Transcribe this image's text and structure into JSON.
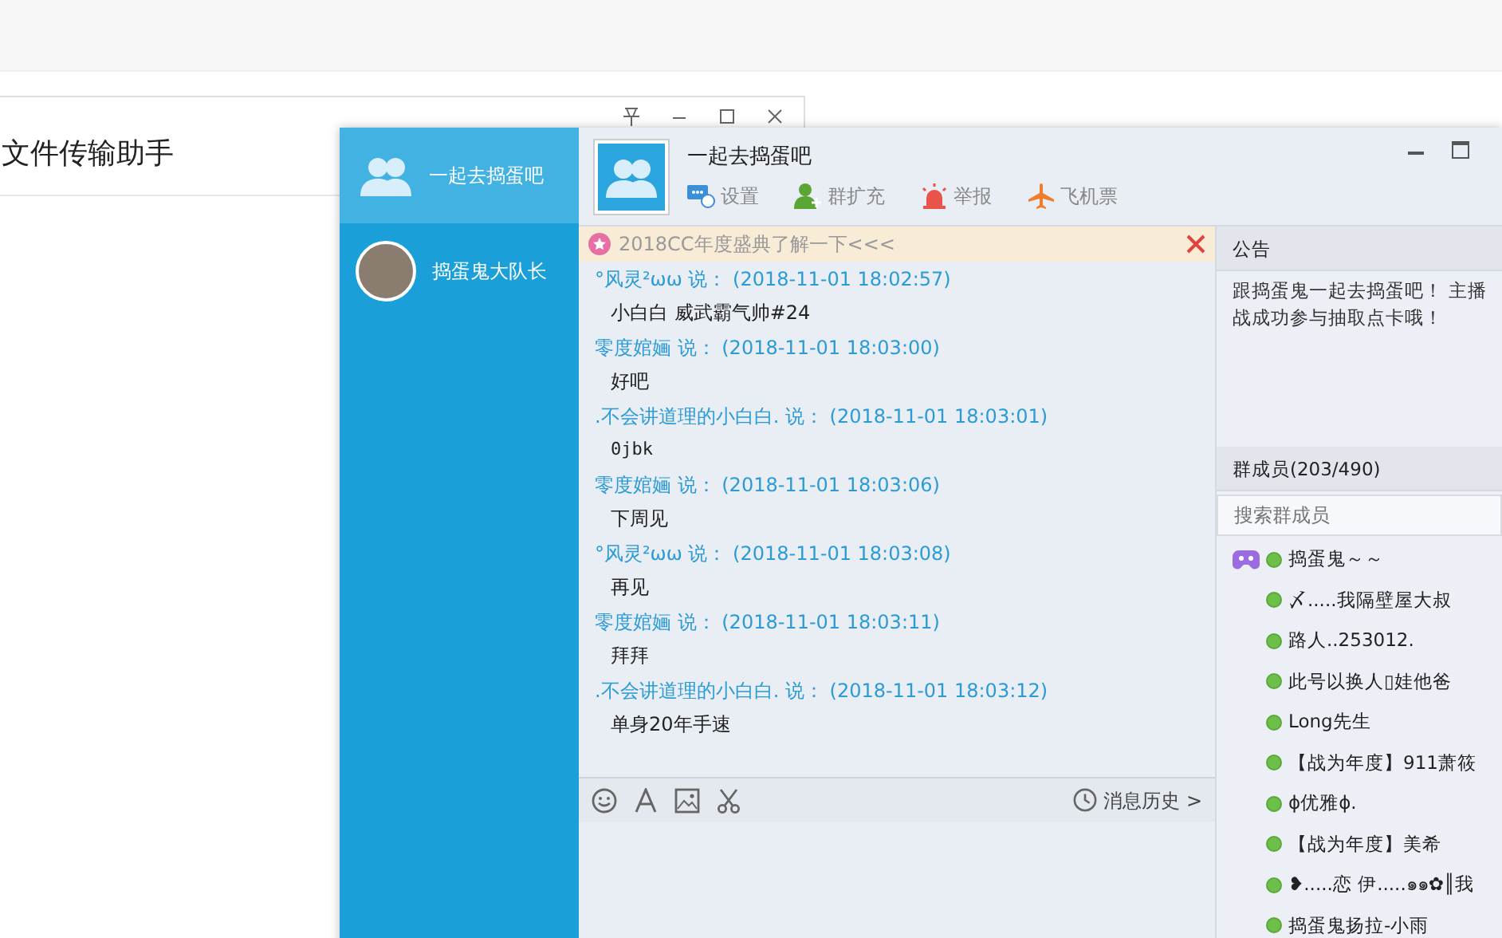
{
  "back_window": {
    "title": "文件传输助手"
  },
  "chat_window": {
    "sessions": [
      {
        "name": "一起去捣蛋吧",
        "kind": "group",
        "selected": true
      },
      {
        "name": "捣蛋鬼大队长",
        "kind": "photo",
        "selected": false
      }
    ],
    "group_name": "一起去捣蛋吧",
    "tools": [
      {
        "label": "设置",
        "kind": "settings"
      },
      {
        "label": "群扩充",
        "kind": "expand"
      },
      {
        "label": "举报",
        "kind": "report"
      },
      {
        "label": "飞机票",
        "kind": "flight"
      }
    ],
    "banner": "2018CC年度盛典了解一下<<<",
    "messages": [
      {
        "sender": "°风灵²ωω",
        "said": "说：",
        "time": "(2018-11-01 18:02:57)",
        "text": "小白白 威武霸气帅#24",
        "kind": "text"
      },
      {
        "sender": "零度婠婳",
        "said": "说：",
        "time": "(2018-11-01 18:03:00)",
        "text": "好吧",
        "kind": "text"
      },
      {
        "sender": ".不会讲道理的小白白.",
        "said": "说：",
        "time": "(2018-11-01 18:03:01)",
        "text": "0jbk",
        "kind": "mono"
      },
      {
        "sender": "零度婠婳",
        "said": "说：",
        "time": "(2018-11-01 18:03:06)",
        "text": "下周见",
        "kind": "text"
      },
      {
        "sender": "°风灵²ωω",
        "said": "说：",
        "time": "(2018-11-01 18:03:08)",
        "text": "再见",
        "kind": "text"
      },
      {
        "sender": "零度婠婳",
        "said": "说：",
        "time": "(2018-11-01 18:03:11)",
        "text": "拜拜",
        "kind": "text"
      },
      {
        "sender": ".不会讲道理的小白白.",
        "said": "说：",
        "time": "(2018-11-01 18:03:12)",
        "text": "单身20年手速",
        "kind": "text"
      }
    ],
    "history_label": "消息历史 >",
    "notice": {
      "title": "公告",
      "lines": [
        "跟捣蛋鬼一起去捣蛋吧！ 主播",
        "战成功参与抽取点卡哦！"
      ]
    },
    "members": {
      "title": "群成员(203/490)",
      "search_placeholder": "搜索群成员",
      "list": [
        {
          "name": "捣蛋鬼～～",
          "kind": "owner"
        },
        {
          "name": "〆.....我隔壁屋大叔",
          "kind": "member"
        },
        {
          "name": "路人..253012.",
          "kind": "member"
        },
        {
          "name": "此号以换人▯娃他爸",
          "kind": "member"
        },
        {
          "name": "Long先生",
          "kind": "member"
        },
        {
          "name": "【战为年度】911萧筱",
          "kind": "member"
        },
        {
          "name": "ɸ优雅ɸ.",
          "kind": "member"
        },
        {
          "name": "【战为年度】美希",
          "kind": "member"
        },
        {
          "name": "❥.....恋 伊.....๑๑✿║我",
          "kind": "member"
        },
        {
          "name": "捣蛋鬼扬拉-小雨",
          "kind": "member"
        }
      ]
    }
  }
}
